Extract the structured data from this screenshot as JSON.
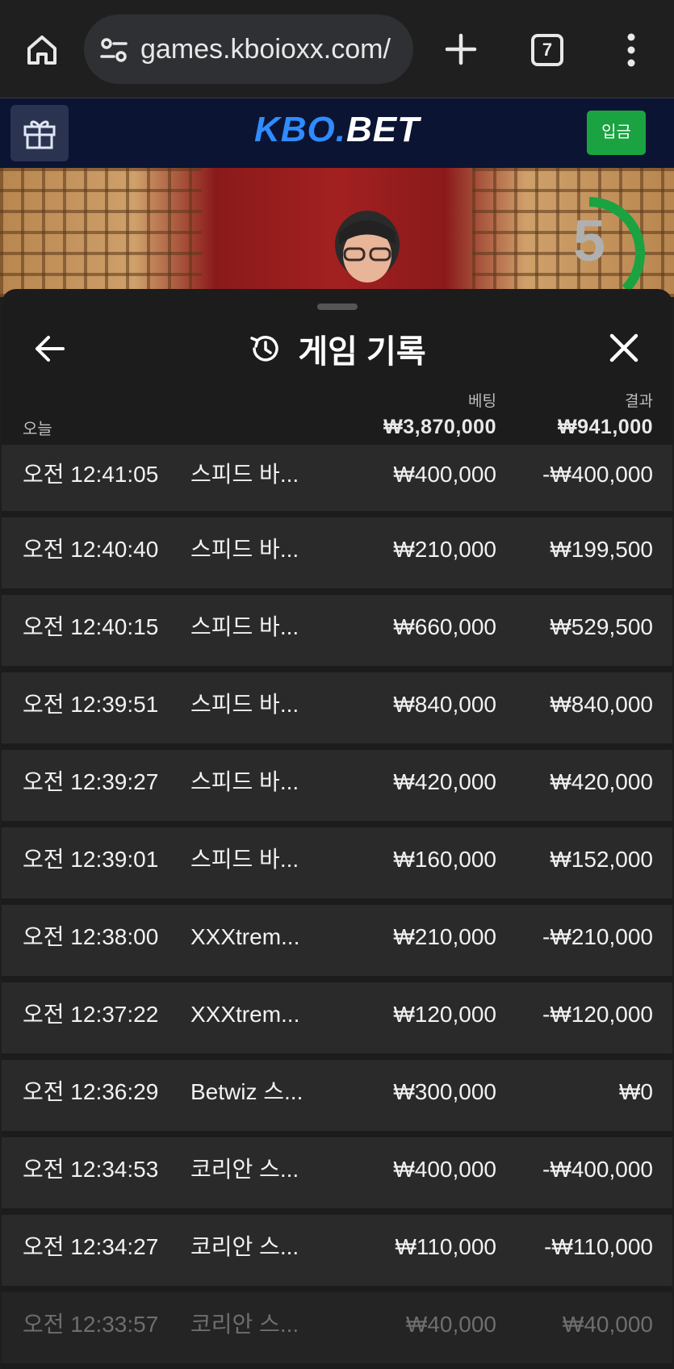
{
  "browser": {
    "url": "games.kboioxx.com/",
    "tab_count": "7",
    "icons": [
      "home-icon",
      "tune-icon",
      "plus-icon",
      "tabs-icon",
      "more-vert-icon"
    ]
  },
  "site": {
    "logo_kbo": "KBO.",
    "logo_bet": "BET",
    "deposit_label": "입금",
    "accent_color": "#2f8cff",
    "deposit_color": "#1aa340"
  },
  "video": {
    "countdown": "5",
    "countdown_color": "#1aa340"
  },
  "history": {
    "title": "게임 기록",
    "today_label": "오늘",
    "bet_label": "베팅",
    "result_label": "결과",
    "total_bet": "₩3,870,000",
    "total_result": "₩941,000",
    "rows": [
      {
        "time": "오전 12:41:05",
        "game": "스피드 바...",
        "bet": "₩400,000",
        "result": "-₩400,000"
      },
      {
        "time": "오전 12:40:40",
        "game": "스피드 바...",
        "bet": "₩210,000",
        "result": "₩199,500"
      },
      {
        "time": "오전 12:40:15",
        "game": "스피드 바...",
        "bet": "₩660,000",
        "result": "₩529,500"
      },
      {
        "time": "오전 12:39:51",
        "game": "스피드 바...",
        "bet": "₩840,000",
        "result": "₩840,000"
      },
      {
        "time": "오전 12:39:27",
        "game": "스피드 바...",
        "bet": "₩420,000",
        "result": "₩420,000"
      },
      {
        "time": "오전 12:39:01",
        "game": "스피드 바...",
        "bet": "₩160,000",
        "result": "₩152,000"
      },
      {
        "time": "오전 12:38:00",
        "game": "XXXtrem...",
        "bet": "₩210,000",
        "result": "-₩210,000"
      },
      {
        "time": "오전 12:37:22",
        "game": "XXXtrem...",
        "bet": "₩120,000",
        "result": "-₩120,000"
      },
      {
        "time": "오전 12:36:29",
        "game": "Betwiz 스...",
        "bet": "₩300,000",
        "result": "₩0"
      },
      {
        "time": "오전 12:34:53",
        "game": "코리안 스...",
        "bet": "₩400,000",
        "result": "-₩400,000"
      },
      {
        "time": "오전 12:34:27",
        "game": "코리안 스...",
        "bet": "₩110,000",
        "result": "-₩110,000"
      },
      {
        "time": "오전 12:33:57",
        "game": "코리안 스...",
        "bet": "₩40,000",
        "result": "₩40,000"
      }
    ]
  }
}
